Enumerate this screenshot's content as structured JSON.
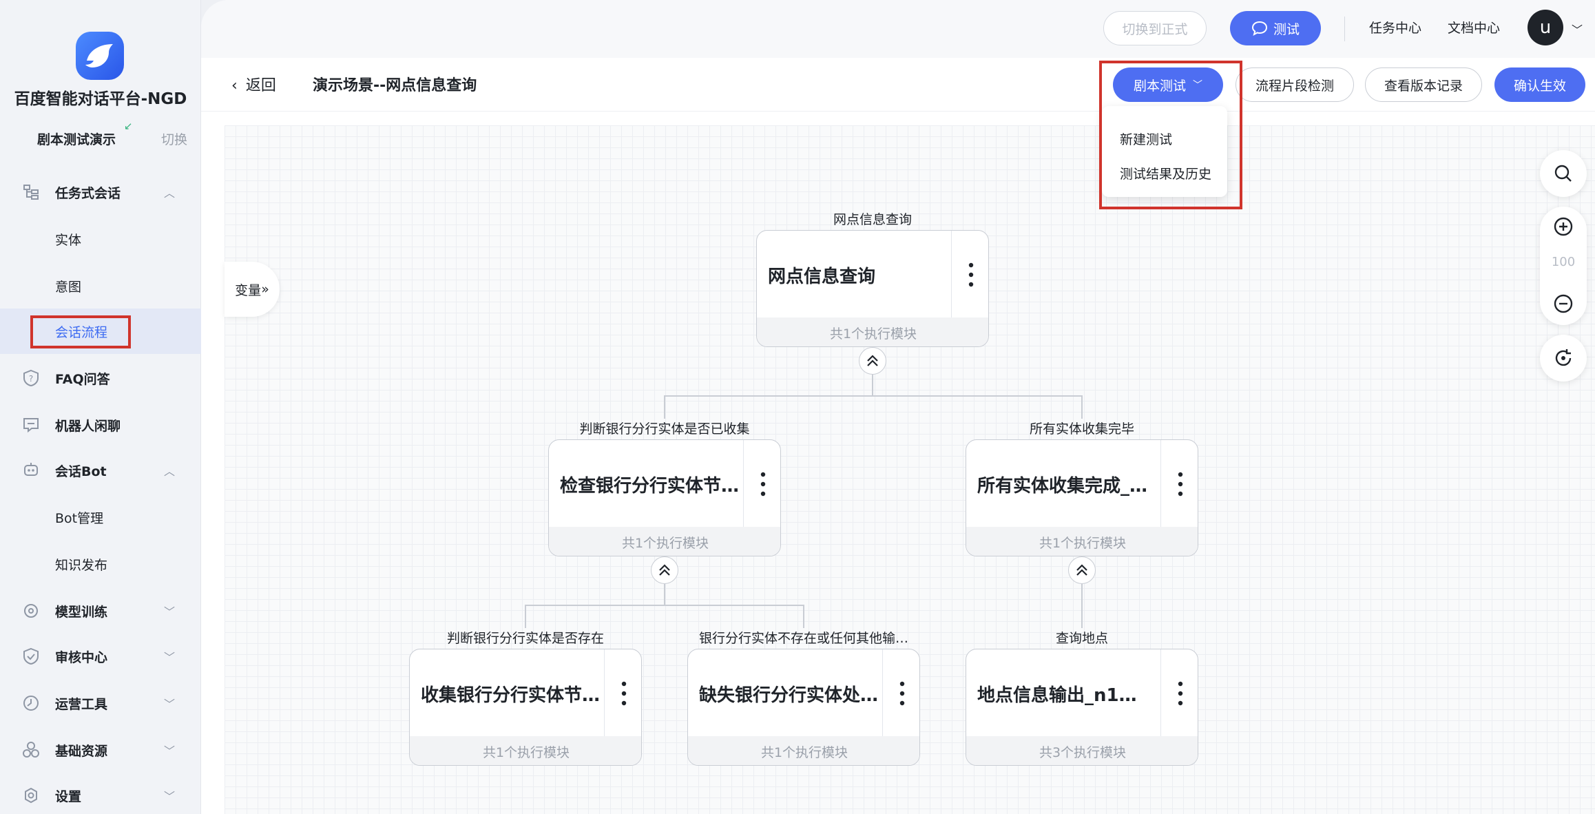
{
  "sidebar": {
    "brand": "百度智能对话平台-NGD",
    "scene": "剧本测试演示",
    "switch_label": "切换",
    "menu": {
      "task_dialog": "任务式会话",
      "entity": "实体",
      "intent": "意图",
      "dialog_flow": "会话流程",
      "faq": "FAQ问答",
      "chitchat": "机器人闲聊",
      "bot": "会话Bot",
      "bot_manage": "Bot管理",
      "knowledge_publish": "知识发布",
      "model_train": "模型训练",
      "review": "审核中心",
      "ops_tools": "运营工具",
      "base_resources": "基础资源",
      "settings": "设置"
    }
  },
  "topbar": {
    "switch_formal": "切换到正式",
    "test": "测试",
    "task_center": "任务中心",
    "doc_center": "文档中心",
    "avatar_letter": "u"
  },
  "header": {
    "back": "返回",
    "title": "演示场景--网点信息查询",
    "script_test": "剧本测试",
    "flow_check": "流程片段检测",
    "version_history": "查看版本记录",
    "confirm": "确认生效"
  },
  "dropdown": {
    "new_test": "新建测试",
    "results_history": "测试结果及历史"
  },
  "canvas": {
    "variables_tab": "变量",
    "zoom_level": "100",
    "nodes": {
      "root": {
        "label": "网点信息查询",
        "name": "网点信息查询",
        "footer": "共1个执行模块"
      },
      "check_branch": {
        "label": "判断银行分行实体是否已收集",
        "name": "检查银行分行实体节…",
        "footer": "共1个执行模块"
      },
      "all_collected": {
        "label": "所有实体收集完毕",
        "name": "所有实体收集完成_…",
        "footer": "共1个执行模块"
      },
      "collect_branch": {
        "label": "判断银行分行实体是否存在",
        "name": "收集银行分行实体节…",
        "footer": "共1个执行模块"
      },
      "missing_branch": {
        "label": "银行分行实体不存在或任何其他输…",
        "name": "缺失银行分行实体处…",
        "footer": "共1个执行模块"
      },
      "location_output": {
        "label": "查询地点",
        "name": "地点信息输出_n1…",
        "footer": "共3个执行模块"
      }
    }
  },
  "colors": {
    "primary": "#4e6ef2",
    "highlight_box": "#d0342c",
    "active_text": "#3d6bf2"
  }
}
